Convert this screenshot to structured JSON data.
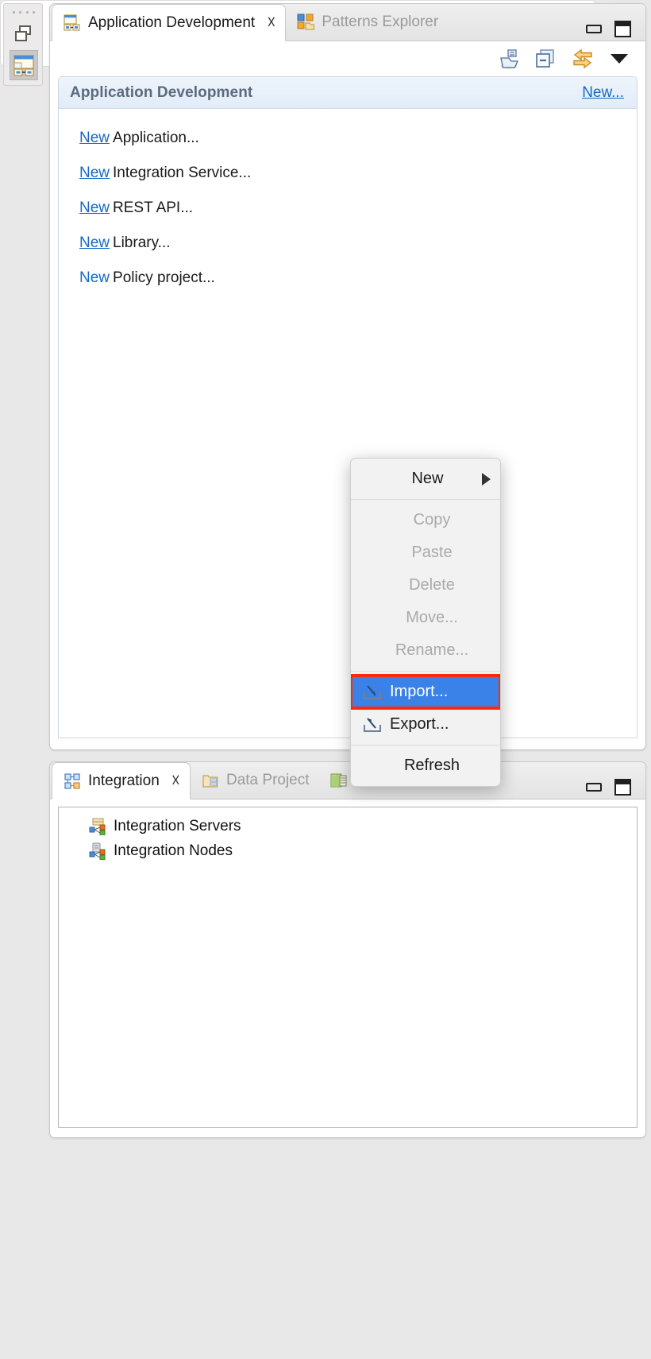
{
  "fastbar": {
    "grip": "drag-grip",
    "buttons": [
      {
        "name": "restore-icon",
        "label": "Restore"
      },
      {
        "name": "app-development-perspective-icon",
        "label": "Application Development"
      }
    ]
  },
  "top_view": {
    "tabs": [
      {
        "label": "Application Development",
        "icon": "application-development-icon",
        "active": true,
        "closable": true
      },
      {
        "label": "Patterns Explorer",
        "icon": "patterns-explorer-icon",
        "active": false,
        "closable": false
      }
    ],
    "window_buttons": [
      {
        "name": "minimize-button",
        "label": "Minimize"
      },
      {
        "name": "maximize-button",
        "label": "Maximize"
      }
    ],
    "toolbar": [
      {
        "name": "import-toolbar-icon",
        "label": "Import"
      },
      {
        "name": "collapse-all-icon",
        "label": "Collapse All"
      },
      {
        "name": "link-with-editor-icon",
        "label": "Link with Editor"
      },
      {
        "name": "view-menu-icon",
        "label": "View Menu"
      }
    ],
    "panel": {
      "title": "Application Development",
      "new_link": "New...",
      "items": [
        {
          "link": "New",
          "text": "Application...",
          "underline": true
        },
        {
          "link": "New",
          "text": "Integration Service...",
          "underline": true
        },
        {
          "link": "New",
          "text": "REST API...",
          "underline": true
        },
        {
          "link": "New",
          "text": "Library...",
          "underline": true
        },
        {
          "link": "New",
          "text": "Policy project...",
          "underline": false
        }
      ]
    }
  },
  "context_menu": {
    "items": [
      {
        "label": "New",
        "state": "normal",
        "submenu": true,
        "icon": null,
        "centered": true
      },
      {
        "separator": true
      },
      {
        "label": "Copy",
        "state": "disabled",
        "submenu": false,
        "icon": null
      },
      {
        "label": "Paste",
        "state": "disabled",
        "submenu": false,
        "icon": null
      },
      {
        "label": "Delete",
        "state": "disabled",
        "submenu": false,
        "icon": null
      },
      {
        "label": "Move...",
        "state": "disabled",
        "submenu": false,
        "icon": null
      },
      {
        "label": "Rename...",
        "state": "disabled",
        "submenu": false,
        "icon": null
      },
      {
        "separator": true
      },
      {
        "label": "Import...",
        "state": "selected",
        "submenu": false,
        "icon": "import-icon"
      },
      {
        "label": "Export...",
        "state": "normal",
        "submenu": false,
        "icon": "export-icon"
      },
      {
        "separator": true
      },
      {
        "label": "Refresh",
        "state": "normal",
        "submenu": false,
        "icon": null,
        "centered": true
      }
    ],
    "highlight": {
      "target": "Import...",
      "color": "#fc2a04"
    },
    "selection_color": "#3b82e8"
  },
  "bottom_view": {
    "tabs": [
      {
        "label": "Integration",
        "icon": "integration-icon",
        "active": true,
        "closable": true
      },
      {
        "label": "Data Project",
        "icon": "data-project-icon",
        "active": false,
        "closable": false
      },
      {
        "label": "Data Source",
        "icon": "data-source-icon",
        "active": false,
        "closable": false
      }
    ],
    "window_buttons": [
      {
        "name": "minimize-button",
        "label": "Minimize"
      },
      {
        "name": "maximize-button",
        "label": "Maximize"
      }
    ],
    "tree": [
      {
        "label": "Integration Servers",
        "icon": "integration-servers-icon"
      },
      {
        "label": "Integration Nodes",
        "icon": "integration-nodes-icon"
      }
    ]
  },
  "colors": {
    "link": "#1569c7",
    "panel_title": "#5b6b7d",
    "selection": "#3b82e8",
    "highlight": "#fc2a04",
    "disabled_text": "#aaaaaa"
  }
}
